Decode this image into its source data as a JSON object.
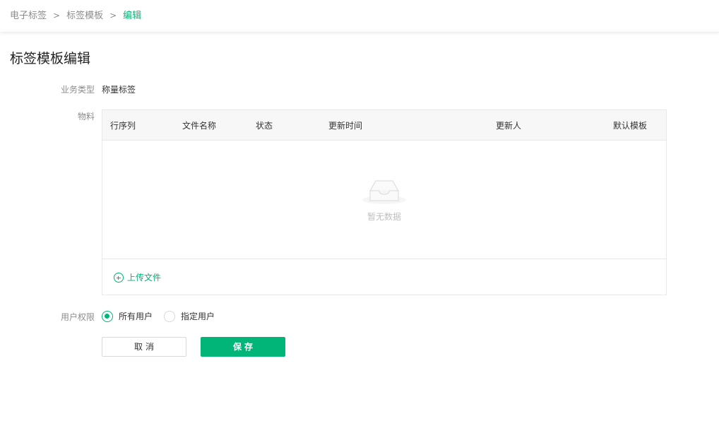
{
  "breadcrumb": {
    "items": [
      "电子标签",
      "标签模板",
      "编辑"
    ],
    "separator": ">"
  },
  "page": {
    "title": "标签模板编辑"
  },
  "form": {
    "business_type": {
      "label": "业务类型",
      "value": "称量标签"
    },
    "material": {
      "label": "物料",
      "columns": [
        "行序列",
        "文件名称",
        "状态",
        "更新时间",
        "更新人",
        "默认模板"
      ],
      "rows": [],
      "empty_text": "暂无数据",
      "upload_label": "上传文件"
    },
    "permission": {
      "label": "用户权限",
      "options": [
        {
          "label": "所有用户",
          "checked": true
        },
        {
          "label": "指定用户",
          "checked": false
        }
      ]
    }
  },
  "buttons": {
    "cancel": "取消",
    "save": "保存"
  },
  "colors": {
    "accent": "#00b578",
    "muted": "#8c8c8c",
    "border": "#e8e8e8"
  },
  "icons": {
    "empty": "inbox-icon",
    "upload": "plus-circle-icon"
  }
}
